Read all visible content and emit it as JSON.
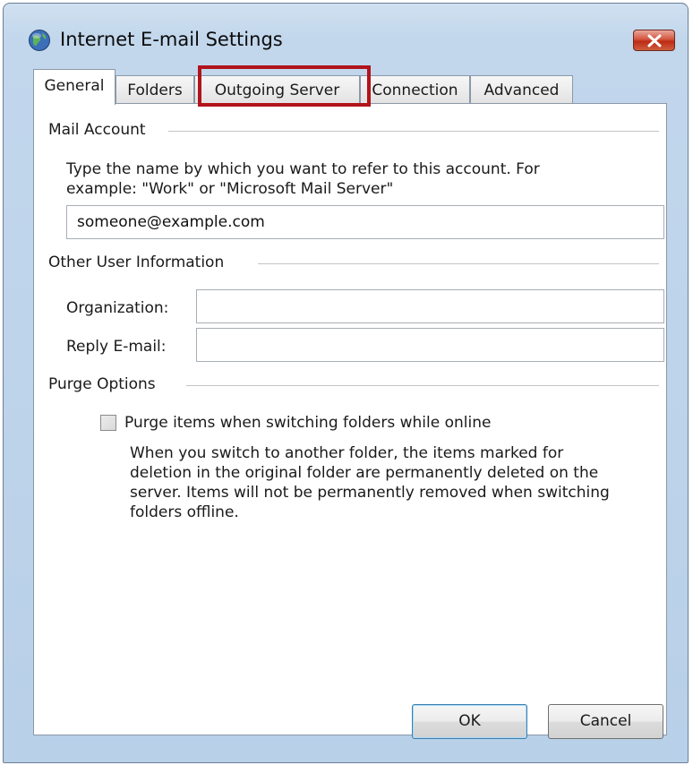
{
  "window": {
    "title": "Internet E-mail Settings",
    "icon": "globe-mail-icon",
    "close_icon": "close-icon"
  },
  "tabs": [
    {
      "label": "General",
      "active": true
    },
    {
      "label": "Folders",
      "active": false
    },
    {
      "label": "Outgoing Server",
      "active": false,
      "highlighted": true
    },
    {
      "label": "Connection",
      "active": false
    },
    {
      "label": "Advanced",
      "active": false
    }
  ],
  "mail_account": {
    "heading": "Mail Account",
    "description_line1": "Type the name by which you want to refer to this account. For",
    "description_line2": "example: \"Work\" or \"Microsoft Mail Server\"",
    "account_name_value": "someone@example.com"
  },
  "other_user_info": {
    "heading": "Other User Information",
    "organization_label": "Organization:",
    "organization_value": "",
    "reply_email_label": "Reply E-mail:",
    "reply_email_value": ""
  },
  "purge_options": {
    "heading": "Purge Options",
    "checkbox_label": "Purge items when switching folders while online",
    "checked": false,
    "help_line1": "When you switch to another folder, the items marked for",
    "help_line2": "deletion in the original folder are permanently deleted on the",
    "help_line3": "server. Items will not be permanently removed when switching",
    "help_line4": "folders offline."
  },
  "buttons": {
    "ok": "OK",
    "cancel": "Cancel"
  },
  "colors": {
    "highlight": "#b1141b",
    "close_button": "#c9412a"
  }
}
